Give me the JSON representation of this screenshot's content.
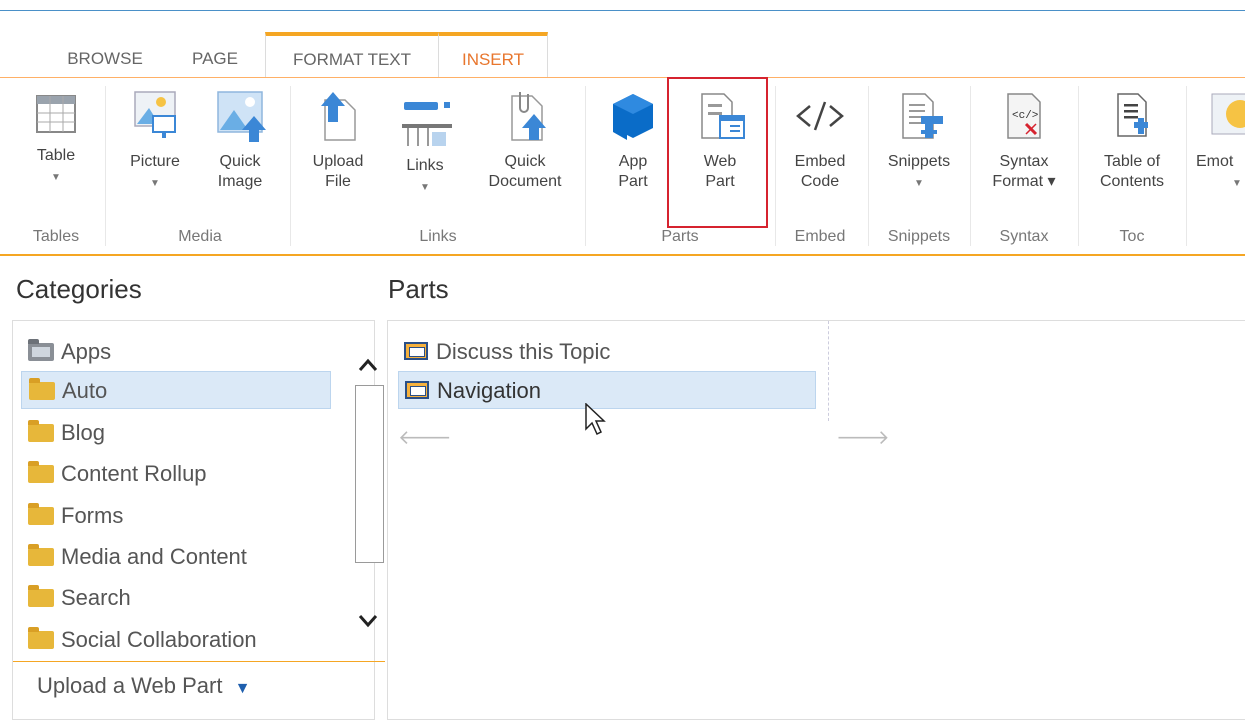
{
  "tabs": [
    {
      "label": "BROWSE"
    },
    {
      "label": "PAGE"
    },
    {
      "label": "FORMAT TEXT"
    },
    {
      "label": "INSERT"
    }
  ],
  "ribbon": {
    "buttons": {
      "table": "Table",
      "picture": "Picture",
      "quick_image": "Quick\nImage",
      "upload_file": "Upload\nFile",
      "links": "Links",
      "quick_document": "Quick\nDocument",
      "app_part": "App\nPart",
      "web_part": "Web\nPart",
      "embed_code": "Embed\nCode",
      "snippets": "Snippets",
      "syntax_format": "Syntax\nFormat ▾",
      "table_of_contents": "Table of\nContents",
      "emoticons": "Emot"
    },
    "groups": {
      "tables": "Tables",
      "media": "Media",
      "links": "Links",
      "parts": "Parts",
      "embed": "Embed",
      "snippets": "Snippets",
      "syntax": "Syntax",
      "toc": "Toc"
    }
  },
  "categories": {
    "heading": "Categories",
    "items": [
      {
        "label": "Apps"
      },
      {
        "label": "Auto"
      },
      {
        "label": "Blog"
      },
      {
        "label": "Content Rollup"
      },
      {
        "label": "Forms"
      },
      {
        "label": "Media and Content"
      },
      {
        "label": "Search"
      },
      {
        "label": "Social Collaboration"
      }
    ],
    "selected": "Auto",
    "upload_label": "Upload a Web Part"
  },
  "parts": {
    "heading": "Parts",
    "items": [
      {
        "label": "Discuss this Topic"
      },
      {
        "label": "Navigation"
      }
    ],
    "selected": "Navigation"
  },
  "colors": {
    "accent": "#f5a623",
    "insert_tab": "#e8762d",
    "highlight_box": "#d6232f",
    "selection": "#dbe9f7"
  }
}
